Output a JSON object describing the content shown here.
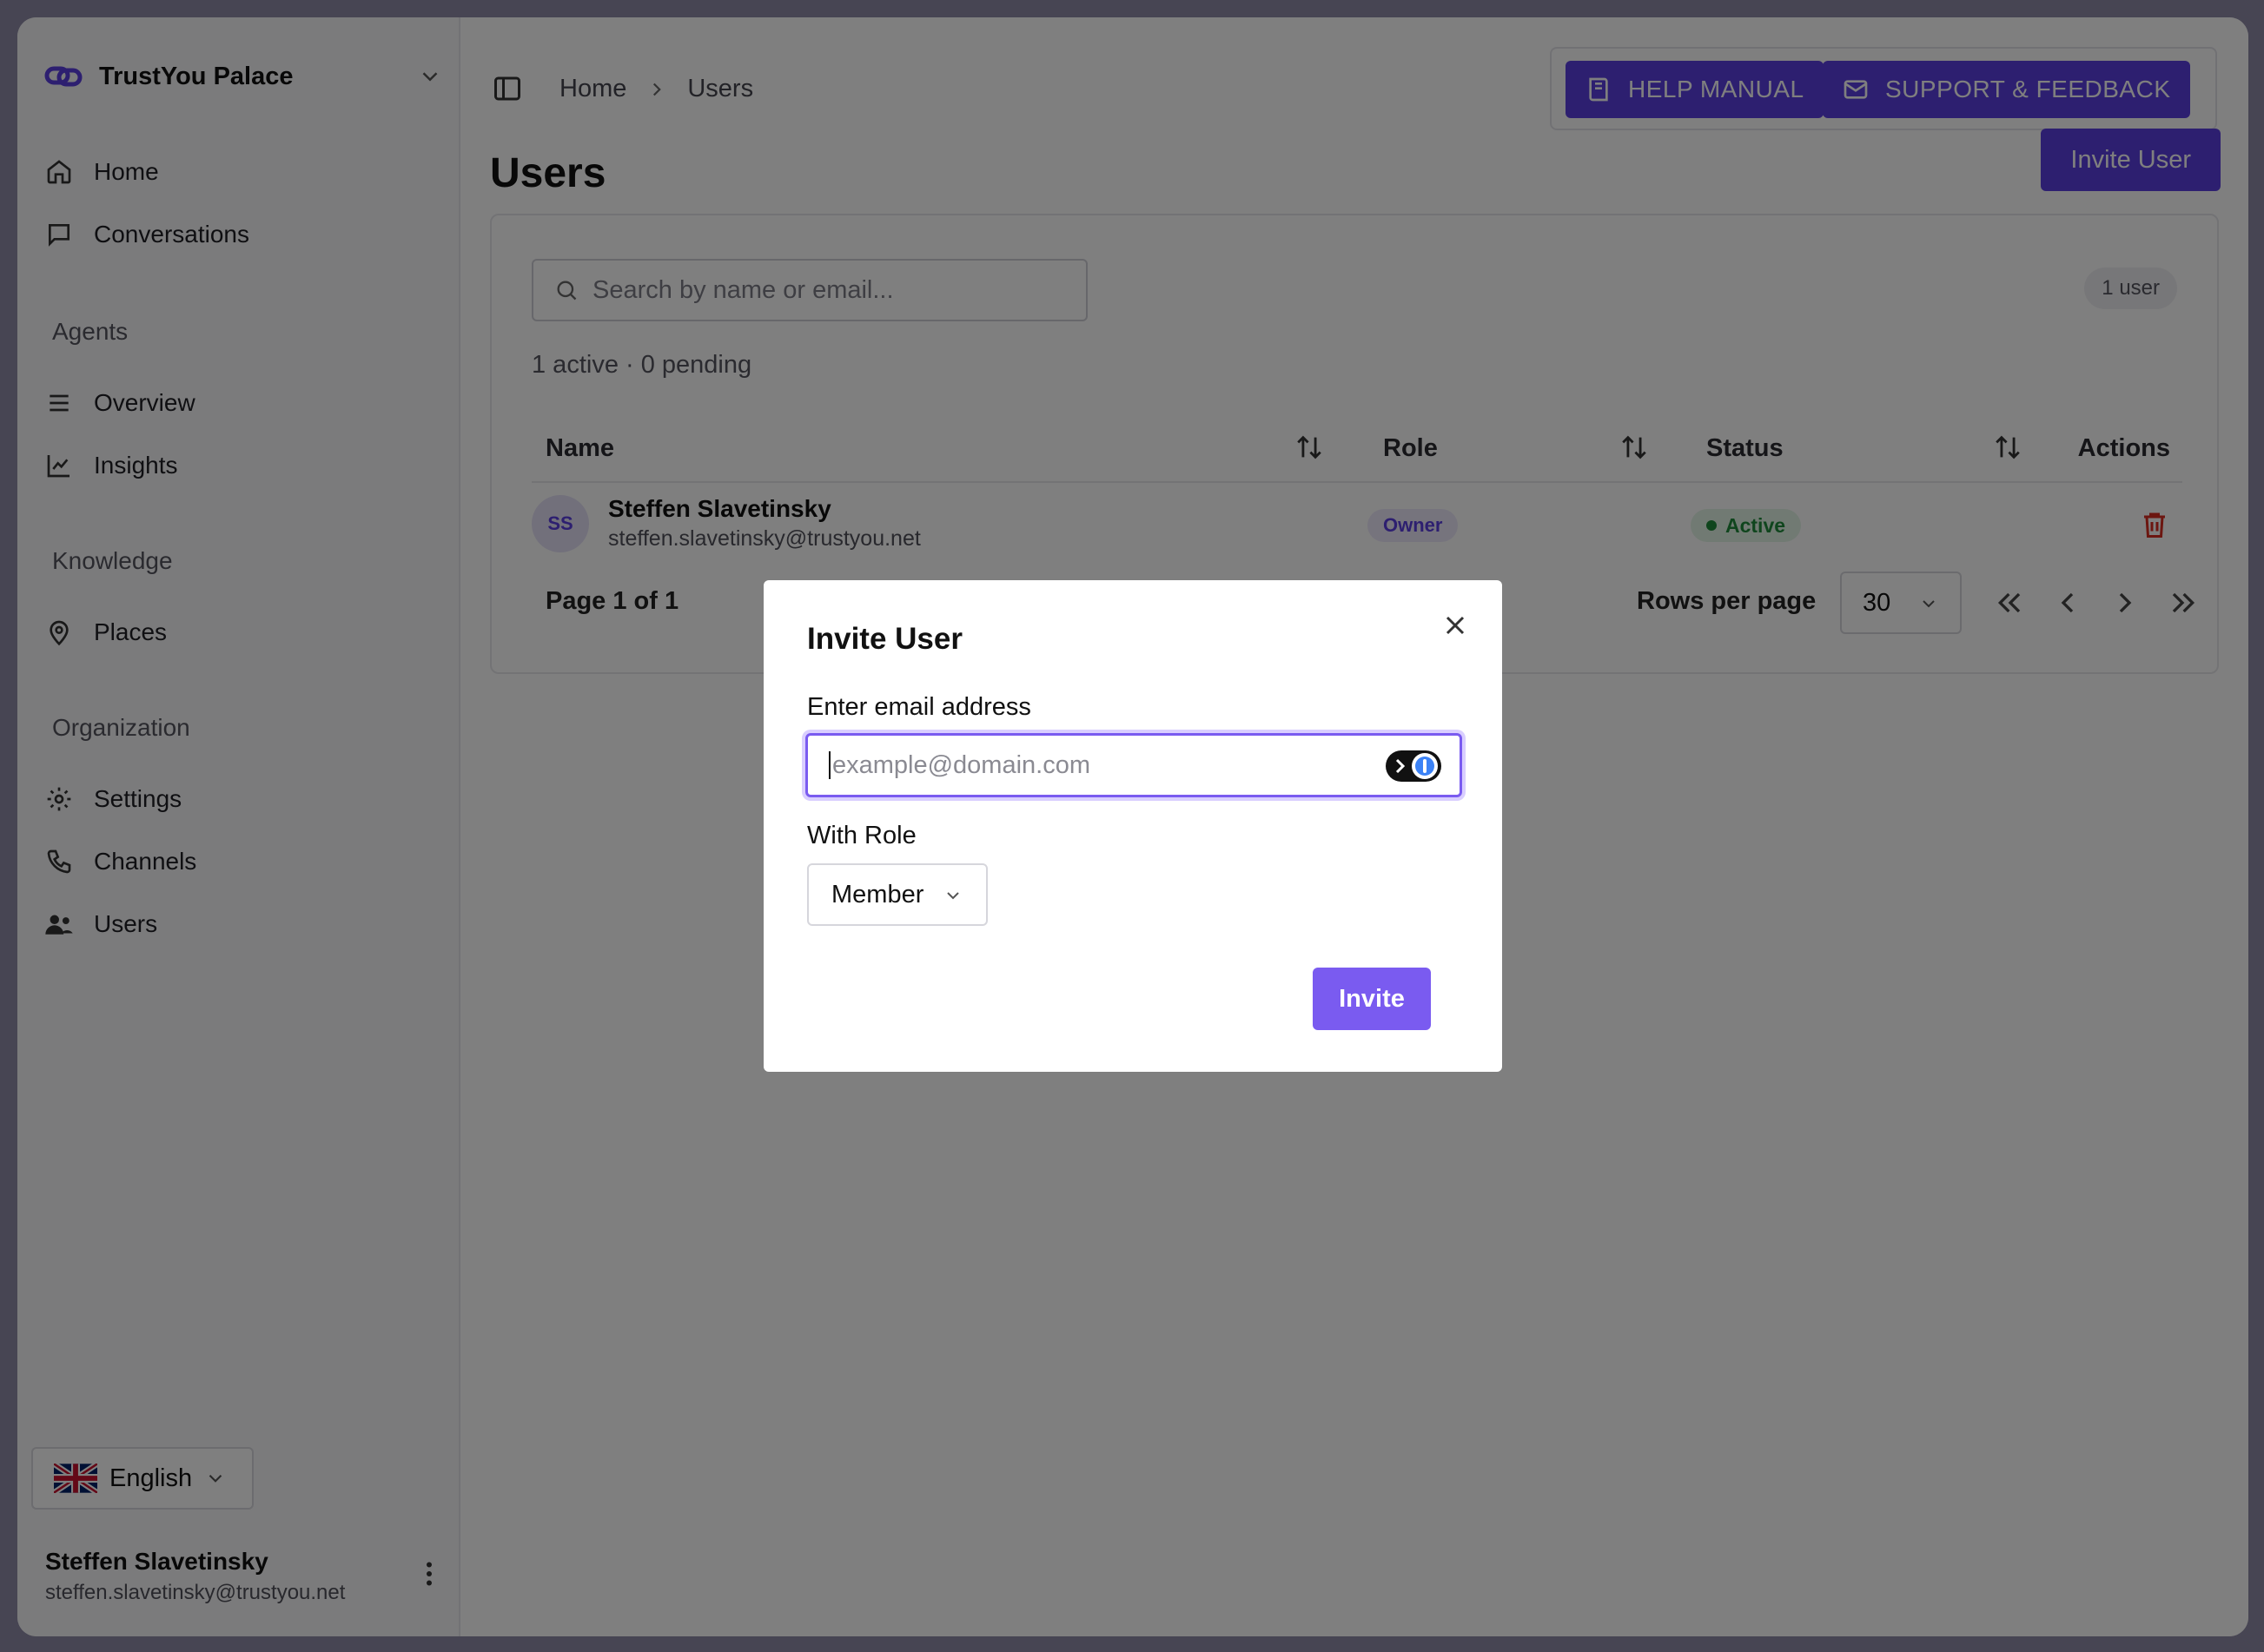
{
  "sidebar": {
    "org_name": "TrustYou Palace",
    "items": [
      {
        "label": "Home",
        "icon": "home-icon"
      },
      {
        "label": "Conversations",
        "icon": "chat-icon"
      },
      {
        "label": "Overview",
        "icon": "list-icon"
      },
      {
        "label": "Insights",
        "icon": "chart-line-icon"
      },
      {
        "label": "Places",
        "icon": "map-pin-icon"
      },
      {
        "label": "Settings",
        "icon": "gear-icon"
      },
      {
        "label": "Channels",
        "icon": "phone-icon"
      },
      {
        "label": "Users",
        "icon": "users-icon"
      }
    ],
    "sections": {
      "agents": "Agents",
      "knowledge": "Knowledge",
      "organization": "Organization"
    },
    "language": "English",
    "user": {
      "name": "Steffen Slavetinsky",
      "email": "steffen.slavetinsky@trustyou.net"
    }
  },
  "header": {
    "breadcrumb": [
      "Home",
      "Users"
    ],
    "help_label": "HELP MANUAL",
    "support_label": "SUPPORT & FEEDBACK"
  },
  "page": {
    "title": "Users",
    "invite_label": "Invite User",
    "search_placeholder": "Search by name or email...",
    "count_badge": "1 user",
    "summary": "1 active · 0 pending",
    "columns": [
      "Name",
      "Role",
      "Status",
      "Actions"
    ],
    "rows": [
      {
        "initials": "SS",
        "name": "Steffen Slavetinsky",
        "email": "steffen.slavetinsky@trustyou.net",
        "role": "Owner",
        "status": "Active"
      }
    ],
    "page_info": "Page 1 of 1",
    "rows_per_page_label": "Rows per page",
    "rows_per_page": "30"
  },
  "modal": {
    "title": "Invite User",
    "email_label": "Enter email address",
    "email_placeholder": "example@domain.com",
    "role_label": "With Role",
    "role_value": "Member",
    "submit_label": "Invite"
  },
  "colors": {
    "accent": "#5b3fe0",
    "accent_light": "#7a5bf0",
    "danger": "#d92d20",
    "success": "#1f8a3b"
  }
}
